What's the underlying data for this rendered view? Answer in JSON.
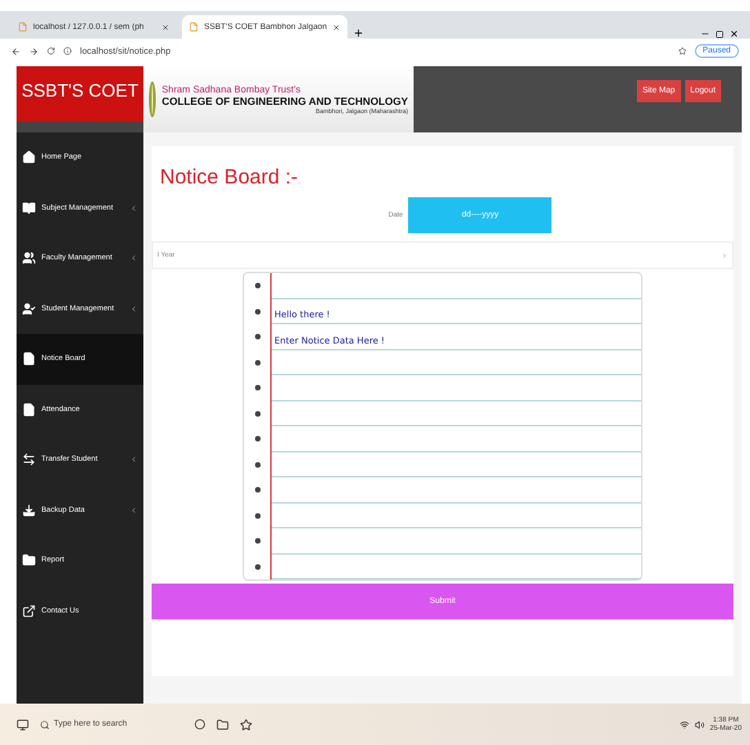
{
  "browser": {
    "tabs": [
      {
        "label": "localhost / 127.0.0.1 / sem (ph",
        "selected": false
      },
      {
        "label": "SSBT'S COET Bambhori Jalgaon",
        "selected": true
      }
    ],
    "address": "localhost/sit/notice.php",
    "profile": "Paused"
  },
  "header": {
    "brand": "SSBT'S COET",
    "trust": "Shram Sadhana Bombay Trust's",
    "college": "COLLEGE OF ENGINEERING AND TECHNOLOGY",
    "place": "Bambhori, Jalgaon (Maharashtra)",
    "buttons": [
      "Site Map",
      "Logout"
    ]
  },
  "sidebar": {
    "items": [
      {
        "label": "Home Page",
        "selected": false,
        "submenu": false
      },
      {
        "label": "Subject Management",
        "selected": false,
        "submenu": true
      },
      {
        "label": "Faculty Management",
        "selected": false,
        "submenu": true
      },
      {
        "label": "Student Management",
        "selected": false,
        "submenu": true
      },
      {
        "label": "Notice Board",
        "selected": true,
        "submenu": false
      },
      {
        "label": "Attendance",
        "selected": false,
        "submenu": false
      },
      {
        "label": "Transfer Student",
        "selected": false,
        "submenu": true
      },
      {
        "label": "Backup Data",
        "selected": false,
        "submenu": true
      },
      {
        "label": "Report",
        "selected": false,
        "submenu": false
      },
      {
        "label": "Contact Us",
        "selected": false,
        "submenu": false
      }
    ]
  },
  "main": {
    "title": "Notice Board :-",
    "date_label": "Date",
    "date_value": "dd----yyyy",
    "year_select": "I Year",
    "notice_lines": [
      "Hello there !",
      "Enter Notice Data Here !"
    ],
    "submit": "Submit"
  },
  "taskbar": {
    "search_placeholder": "Type here to search",
    "time": "1:38 PM",
    "date": "25-Mar-20"
  }
}
